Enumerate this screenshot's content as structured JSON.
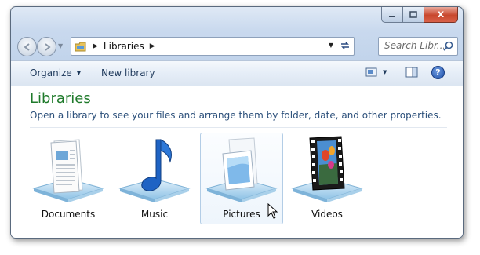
{
  "window": {
    "caption_buttons": {
      "minimize_icon": "minimize-icon",
      "maximize_icon": "maximize-icon",
      "close_icon": "close-icon",
      "close_glyph": "x"
    }
  },
  "navigation": {
    "back_icon": "back-arrow-icon",
    "forward_icon": "forward-arrow-icon",
    "address": {
      "folder_icon": "libraries-folder-icon",
      "crumbs": [
        "Libraries"
      ]
    },
    "search": {
      "placeholder": "Search Libr..."
    }
  },
  "toolbar": {
    "organize_label": "Organize",
    "new_library_label": "New library"
  },
  "header": {
    "title": "Libraries",
    "subtitle": "Open a library to see your files and arrange them by folder, date, and other properties."
  },
  "libraries": [
    {
      "label": "Documents",
      "icon": "documents-library-icon"
    },
    {
      "label": "Music",
      "icon": "music-library-icon"
    },
    {
      "label": "Pictures",
      "icon": "pictures-library-icon",
      "selected": true
    },
    {
      "label": "Videos",
      "icon": "videos-library-icon"
    }
  ],
  "colors": {
    "title_green": "#1f7a2b",
    "subtitle_blue": "#2b4f7a",
    "toolbar_text": "#1e395b",
    "close_red": "#c8462c"
  }
}
